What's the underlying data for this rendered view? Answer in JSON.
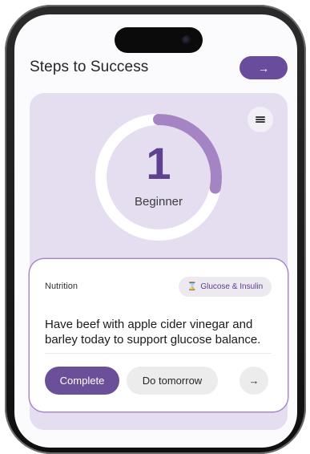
{
  "header": {
    "title": "Steps to Success",
    "arrow_icon": "arrow-right-icon",
    "arrow_glyph": "→"
  },
  "progress": {
    "level": "1",
    "label": "Beginner",
    "fraction": 0.28,
    "colors": {
      "track": "#ffffff",
      "fill": "#a584c4",
      "accent": "#5e418f"
    }
  },
  "task": {
    "category": "Nutrition",
    "tag": {
      "icon": "hourglass-icon",
      "glyph": "⌛",
      "label": "Glucose & Insulin"
    },
    "text": "Have beef with apple cider vinegar and barley today to support glucose balance.",
    "actions": {
      "complete": "Complete",
      "tomorrow": "Do tomorrow",
      "next_glyph": "→"
    }
  },
  "colors": {
    "brand": "#6a4c9c",
    "card_bg": "#e5ddf0"
  }
}
